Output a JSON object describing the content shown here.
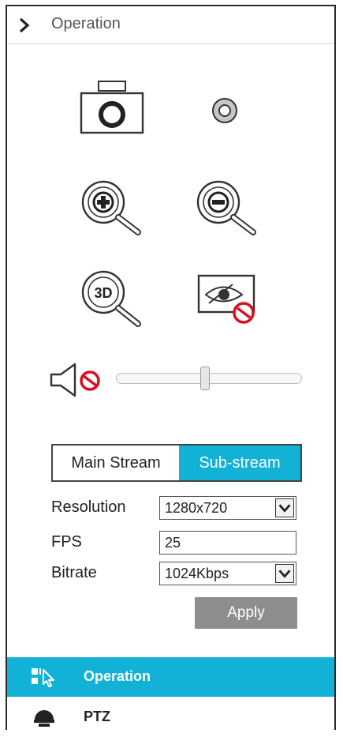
{
  "header": {
    "title": "Operation",
    "icon": "chevron-right-icon"
  },
  "tools": {
    "snapshot": "camera-icon",
    "record": "record-icon",
    "zoom_in": "zoom-in-icon",
    "zoom_out": "zoom-out-icon",
    "zoom_3d": "zoom-3d-icon",
    "privacy": "eye-disabled-icon",
    "audio": "speaker-muted-icon"
  },
  "volume": {
    "level": 0.48
  },
  "stream": {
    "tabs": [
      {
        "label": "Main Stream",
        "selected": false
      },
      {
        "label": "Sub-stream",
        "selected": true
      }
    ],
    "accent": "#12b1d6"
  },
  "form": {
    "resolution_label": "Resolution",
    "resolution_value": "1280x720",
    "fps_label": "FPS",
    "fps_value": "25",
    "bitrate_label": "Bitrate",
    "bitrate_value": "1024Kbps",
    "apply_label": "Apply"
  },
  "nav": {
    "items": [
      {
        "label": "Operation",
        "icon": "cursor-select-icon",
        "active": true
      },
      {
        "label": "PTZ",
        "icon": "dome-camera-icon",
        "active": false
      }
    ]
  }
}
